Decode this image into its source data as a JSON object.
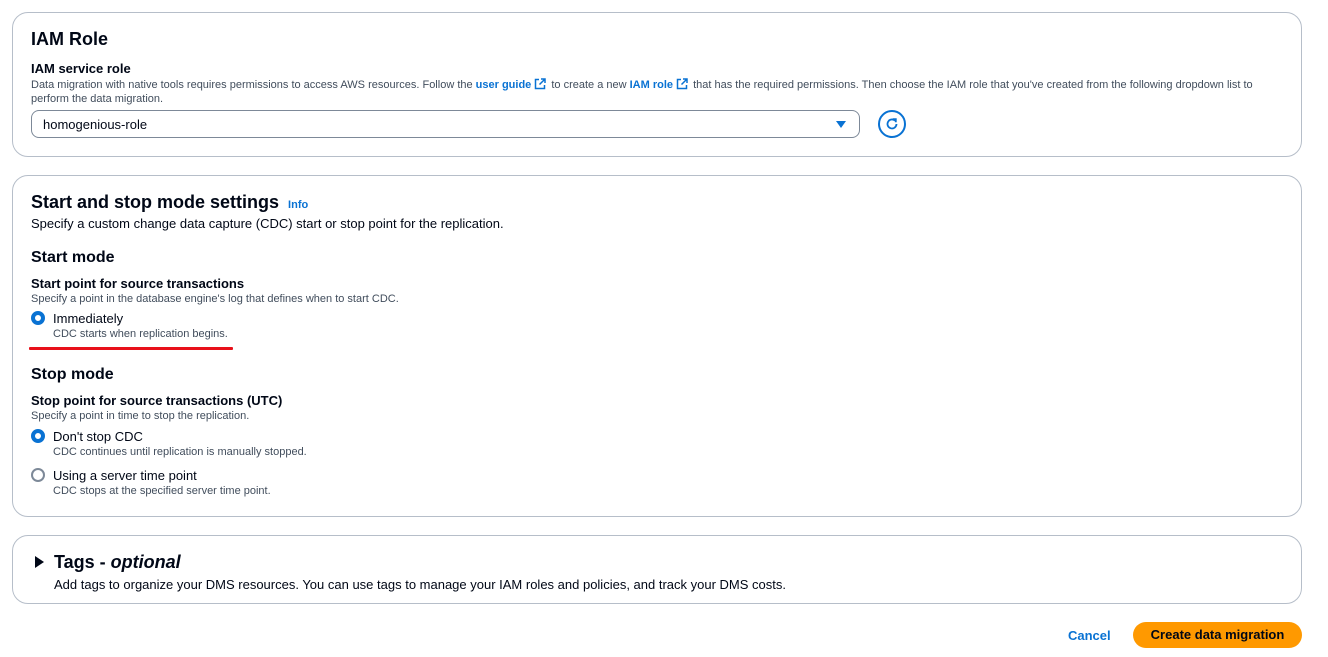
{
  "iam": {
    "title": "IAM Role",
    "service_role_label": "IAM service role",
    "desc_part1": "Data migration with native tools requires permissions to access AWS resources. Follow the ",
    "user_guide_link": "user guide",
    "desc_part2": " to create a new ",
    "iam_role_link": "IAM role",
    "desc_part3": " that has the required permissions. Then choose the IAM role that you've created from the following dropdown list to",
    "desc_line2": "perform the data migration.",
    "selected_role": "homogenious-role"
  },
  "mode": {
    "title": "Start and stop mode settings",
    "info_link": "Info",
    "subtitle": "Specify a custom change data capture (CDC) start or stop point for the replication.",
    "start_heading": "Start mode",
    "start_label": "Start point for source transactions",
    "start_desc": "Specify a point in the database engine's log that defines when to start CDC.",
    "start_options": [
      {
        "label": "Immediately",
        "desc": "CDC starts when replication begins.",
        "checked": true
      }
    ],
    "stop_heading": "Stop mode",
    "stop_label": "Stop point for source transactions (UTC)",
    "stop_desc": "Specify a point in time to stop the replication.",
    "stop_options": [
      {
        "label": "Don't stop CDC",
        "desc": "CDC continues until replication is manually stopped.",
        "checked": true
      },
      {
        "label": "Using a server time point",
        "desc": "CDC stops at the specified server time point.",
        "checked": false
      }
    ]
  },
  "tags": {
    "title": "Tags - ",
    "title_optional": "optional",
    "desc": "Add tags to organize your DMS resources. You can use tags to manage your IAM roles and policies, and track your DMS costs."
  },
  "actions": {
    "cancel_label": "Cancel",
    "create_label": "Create data migration"
  },
  "colors": {
    "link": "#0972d3",
    "primary_button": "#ff9900",
    "annotation_underline": "#e8101a"
  },
  "icons": {
    "external_link": "external-link-icon",
    "refresh": "refresh-icon",
    "caret": "caret-down-icon",
    "expand": "expand-triangle-icon"
  }
}
